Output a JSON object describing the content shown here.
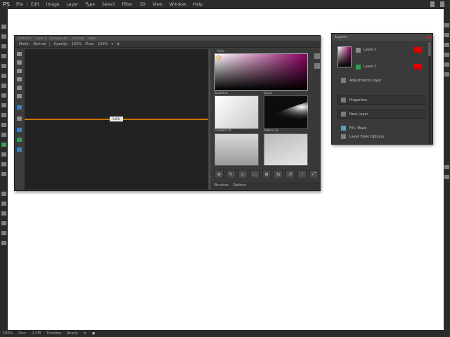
{
  "menubar": {
    "logo": "PS",
    "items": [
      "File",
      "Edit",
      "Image",
      "Layer",
      "Type",
      "Select",
      "Filter",
      "3D",
      "View",
      "Window",
      "Help"
    ]
  },
  "main_window": {
    "tabs": [
      "Untitled-1",
      "Layer 1",
      "Background",
      "Channels",
      "Paths"
    ],
    "toolbar": [
      "Mode:",
      "Normal",
      "Opacity:",
      "100%",
      "Flow:",
      "100%",
      "▾",
      "⚙"
    ],
    "canvas_tag": "100%"
  },
  "subpanel": {
    "color_label": "Color",
    "swatch1_label": "Swatches",
    "swatch2_label": "Styles",
    "swatch3_label": "Gradient Fill",
    "swatch4_label": "Pattern Fill",
    "buttons": [
      "⊕",
      "✎",
      "◇",
      "⬚",
      "⊞",
      "⇆",
      "↺",
      "∕",
      "⤢"
    ],
    "tabs": [
      "Brushes",
      "Options"
    ]
  },
  "float_panel": {
    "title": "Layers",
    "rows": [
      {
        "label": "Layer 1"
      },
      {
        "label": "Layer 2"
      }
    ],
    "boxes": [
      {
        "label": "Adjustments layer"
      },
      {
        "label": "Properties"
      },
      {
        "label": "New Layer"
      },
      {
        "label": "Fill / Mask"
      },
      {
        "label": "Layer Style Options"
      }
    ]
  },
  "statusbar": {
    "items": [
      "100%",
      "Doc:",
      "1.2M",
      "Timeline",
      "Ready",
      "⟳",
      "●"
    ]
  }
}
